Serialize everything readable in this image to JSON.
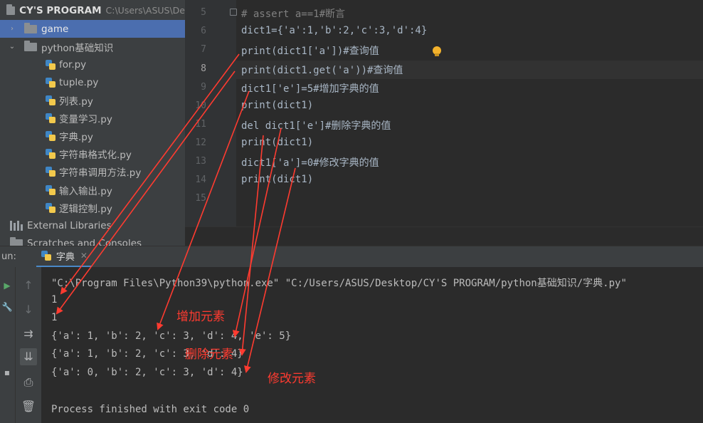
{
  "project": {
    "title": "CY'S PROGRAM",
    "path": "C:\\Users\\ASUS\\De",
    "items": [
      {
        "label": "game",
        "type": "folder",
        "expanded": false,
        "selected": true
      },
      {
        "label": "python基础知识",
        "type": "folder",
        "expanded": true
      },
      {
        "label": "for.py",
        "type": "file"
      },
      {
        "label": "tuple.py",
        "type": "file"
      },
      {
        "label": "列表.py",
        "type": "file"
      },
      {
        "label": "变量学习.py",
        "type": "file"
      },
      {
        "label": "字典.py",
        "type": "file"
      },
      {
        "label": "字符串格式化.py",
        "type": "file"
      },
      {
        "label": "字符串调用方法.py",
        "type": "file"
      },
      {
        "label": "输入输出.py",
        "type": "file"
      },
      {
        "label": "逻辑控制.py",
        "type": "file"
      }
    ],
    "external": "External Libraries",
    "scratches": "Scratches and Consoles"
  },
  "editor": {
    "line_numbers": [
      "5",
      "6",
      "7",
      "8",
      "9",
      "10",
      "11",
      "12",
      "13",
      "14",
      "15"
    ],
    "current_line": "8",
    "lines": [
      "# assert a==1#断言",
      "dict1={'a':1,'b':2,'c':3,'d':4}",
      "print(dict1['a'])#查询值",
      "print(dict1.get('a'))#查询值",
      "dict1['e']=5#增加字典的值",
      "print(dict1)",
      "del dict1['e']#删除字典的值",
      "print(dict1)",
      "dict1['a']=0#修改字典的值",
      "print(dict1)",
      ""
    ]
  },
  "run": {
    "label": "un:",
    "tab_label": "字典",
    "output": [
      "\"C:\\Program Files\\Python39\\python.exe\" \"C:/Users/ASUS/Desktop/CY'S PROGRAM/python基础知识/字典.py\"",
      "1",
      "1",
      "{'a': 1, 'b': 2, 'c': 3, 'd': 4, 'e': 5}",
      "{'a': 1, 'b': 2, 'c': 3, 'd': 4}",
      "{'a': 0, 'b': 2, 'c': 3, 'd': 4}",
      "",
      "Process finished with exit code 0"
    ]
  },
  "annotations": {
    "add": "增加元素",
    "del": "删除元素",
    "modify": "修改元素",
    "color": "#ff3b30"
  },
  "icons": [
    "folder-icon",
    "python-file-icon",
    "library-icon",
    "rerun-icon",
    "scroll-up-icon",
    "scroll-down-icon",
    "soft-wrap-icon",
    "scroll-to-end-icon",
    "print-icon",
    "trash-icon",
    "bulb-icon"
  ]
}
